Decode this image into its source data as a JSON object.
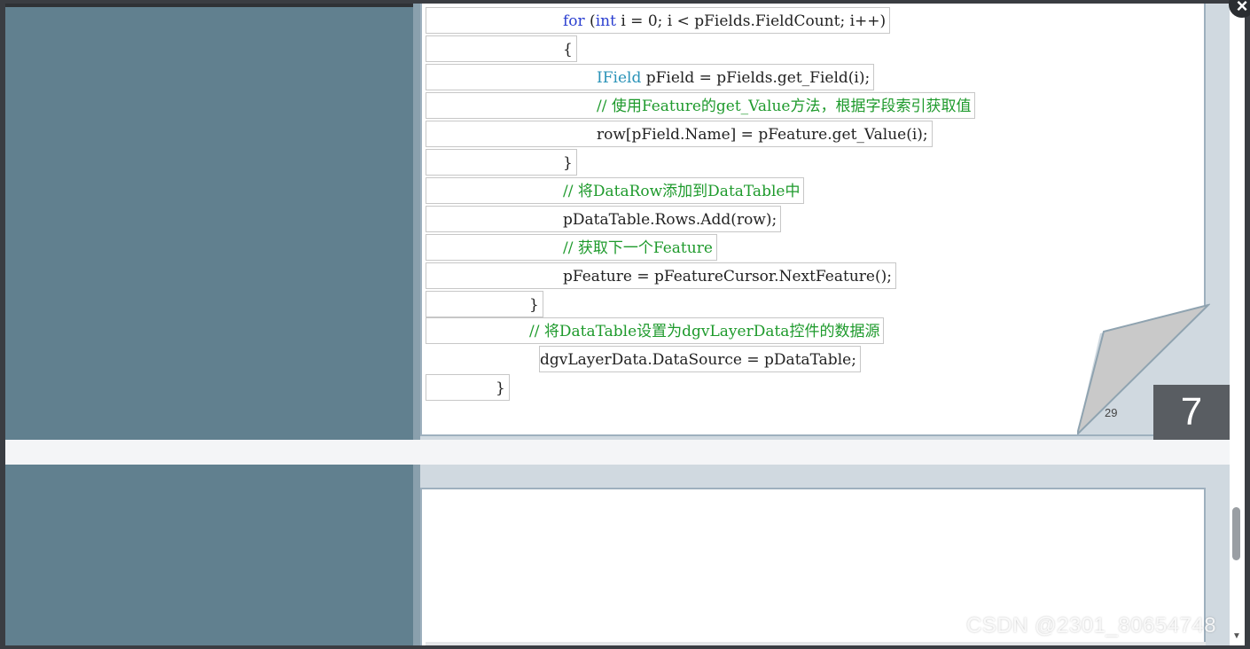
{
  "code_lines": [
    [
      {
        "t": "for",
        "c": "kw"
      },
      {
        "t": " ("
      },
      {
        "t": "int",
        "c": "kw"
      },
      {
        "t": " i = 0; i < pFields.FieldCount; i++)"
      }
    ],
    [
      {
        "t": "{"
      }
    ],
    [
      {
        "t": "IField",
        "c": "type"
      },
      {
        "t": " pField = pFields.get_Field(i);"
      }
    ],
    [
      {
        "t": "// 使用Feature的get_Value方法，根据字段索引获取值",
        "c": "cm"
      }
    ],
    [
      {
        "t": "row[pField.Name] = pFeature.get_Value(i);"
      }
    ],
    [
      {
        "t": "}"
      }
    ],
    [
      {
        "t": "// 将DataRow添加到DataTable中",
        "c": "cm"
      }
    ],
    [
      {
        "t": "pDataTable.Rows.Add(row);"
      }
    ],
    [
      {
        "t": "// 获取下一个Feature",
        "c": "cm"
      }
    ],
    [
      {
        "t": "pFeature = pFeatureCursor.NextFeature();"
      }
    ],
    [
      {
        "t": "}"
      }
    ],
    [
      {
        "t": "// 将DataTable设置为dgvLayerData控件的数据源",
        "c": "cm"
      }
    ],
    [
      {
        "t": "dgvLayerData.DataSource = pDataTable;"
      }
    ],
    [
      {
        "t": "}"
      }
    ]
  ],
  "page_number": "29",
  "slide_badge": "7",
  "watermark": "CSDN @2301_80654748",
  "close_icon": "×",
  "colors": {
    "keyword": "#2b3fd0",
    "type": "#2a93b8",
    "comment": "#1e9a2c",
    "sidebar": "#61808f"
  },
  "icons": [
    "close-icon",
    "page-curl-icon",
    "scroll-down-icon"
  ]
}
